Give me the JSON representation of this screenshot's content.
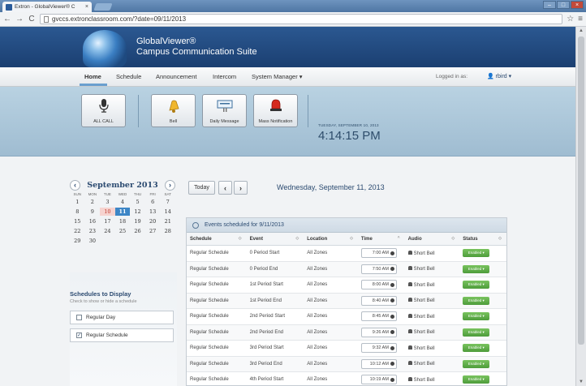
{
  "browser": {
    "tab_title": "Extron - GlobalViewer® C",
    "tab_close": "×",
    "back": "←",
    "forward": "→",
    "reload": "C",
    "url": "gvccs.extronclassroom.com/?date=09/11/2013",
    "star": "☆",
    "menu": "≡",
    "win_min": "–",
    "win_max": "□",
    "win_close": "×"
  },
  "brand": {
    "line1": "GlobalViewer®",
    "line2": "Campus Communication Suite"
  },
  "nav": {
    "items": [
      "Home",
      "Schedule",
      "Announcement",
      "Intercom",
      "System Manager ▾"
    ],
    "logged_in_label": "Logged in as:",
    "user": "rbird ▾"
  },
  "quick_actions": [
    {
      "label": "ALL CALL",
      "icon": "microphone-icon"
    },
    {
      "label": "Bell",
      "icon": "bell-icon"
    },
    {
      "label": "Daily Message",
      "icon": "message-icon"
    },
    {
      "label": "Mass Notification",
      "icon": "alarm-icon"
    }
  ],
  "datetime": {
    "date_label": "TUESDAY, SEPTEMBER 10, 2013",
    "time": "4:14:15 PM"
  },
  "calendar": {
    "title": "September 2013",
    "prev": "‹",
    "next": "›",
    "dows": [
      "SUN",
      "MON",
      "TUE",
      "WED",
      "THU",
      "FRI",
      "SAT"
    ],
    "days": [
      "1",
      "2",
      "3",
      "4",
      "5",
      "6",
      "7",
      "8",
      "9",
      "10",
      "11",
      "12",
      "13",
      "14",
      "15",
      "16",
      "17",
      "18",
      "19",
      "20",
      "21",
      "22",
      "23",
      "24",
      "25",
      "26",
      "27",
      "28",
      "29",
      "30"
    ],
    "today": "10",
    "selected": "11"
  },
  "schedules": {
    "title": "Schedules to Display",
    "hint": "Check to show or hide a schedule",
    "options": [
      {
        "label": "Regular Day",
        "checked": false
      },
      {
        "label": "Regular Schedule",
        "checked": true
      }
    ]
  },
  "main": {
    "today_btn": "Today",
    "prev_btn": "‹",
    "next_btn": "›",
    "date_heading": "Wednesday, September 11, 2013"
  },
  "events": {
    "title": "Events scheduled for 9/11/2013",
    "columns": [
      "Schedule",
      "Event",
      "Location",
      "Time",
      "Audio",
      "Status"
    ],
    "rows": [
      [
        "Regular Schedule",
        "0 Period Start",
        "All Zones",
        "7:00 AM",
        "Short Bell",
        "Enabled ▾"
      ],
      [
        "Regular Schedule",
        "0 Period End",
        "All Zones",
        "7:50 AM",
        "Short Bell",
        "Enabled ▾"
      ],
      [
        "Regular Schedule",
        "1st Period Start",
        "All Zones",
        "8:00 AM",
        "Short Bell",
        "Enabled ▾"
      ],
      [
        "Regular Schedule",
        "1st Period End",
        "All Zones",
        "8:40 AM",
        "Short Bell",
        "Enabled ▾"
      ],
      [
        "Regular Schedule",
        "2nd Period Start",
        "All Zones",
        "8:45 AM",
        "Short Bell",
        "Enabled ▾"
      ],
      [
        "Regular Schedule",
        "2nd Period End",
        "All Zones",
        "9:26 AM",
        "Short Bell",
        "Enabled ▾"
      ],
      [
        "Regular Schedule",
        "3rd Period Start",
        "All Zones",
        "9:32 AM",
        "Short Bell",
        "Enabled ▾"
      ],
      [
        "Regular Schedule",
        "3rd Period End",
        "All Zones",
        "10:12 AM",
        "Short Bell",
        "Enabled ▾"
      ],
      [
        "Regular Schedule",
        "4th Period Start",
        "All Zones",
        "10:19 AM",
        "Short Bell",
        "Enabled ▾"
      ]
    ]
  },
  "colors": {
    "banner": "#2b5891",
    "accent": "#3d86c6",
    "status_enabled": "#5aa845"
  }
}
